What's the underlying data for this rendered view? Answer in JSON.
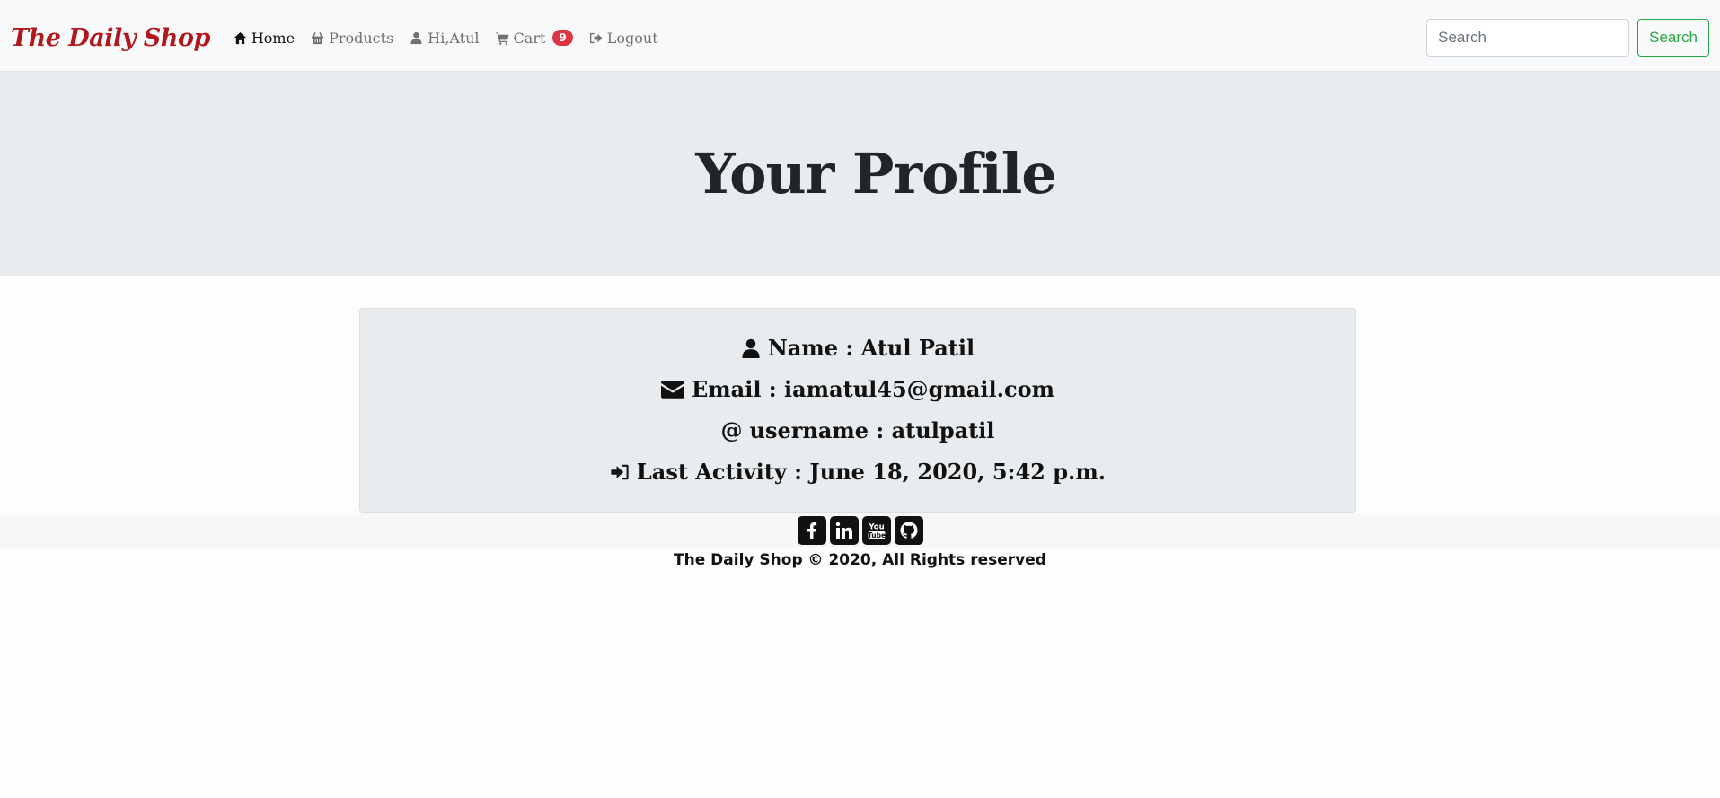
{
  "nav": {
    "brand": "The Daily Shop",
    "items": [
      {
        "label": "Home",
        "icon": "home-icon",
        "active": true
      },
      {
        "label": "Products",
        "icon": "basket-icon"
      },
      {
        "label": "Hi,Atul",
        "icon": "user-icon"
      },
      {
        "label": "Cart",
        "icon": "cart-icon",
        "badge": "9"
      },
      {
        "label": "Logout",
        "icon": "logout-icon"
      }
    ],
    "search_placeholder": "Search",
    "search_button": "Search"
  },
  "header": {
    "title": "Your Profile"
  },
  "profile": {
    "name_label": "Name : Atul Patil",
    "email_label": "Email : iamatul45@gmail.com",
    "username_prefix": "@",
    "username_label": "username : atulpatil",
    "activity_label": "Last Activity : June 18, 2020, 5:42 p.m."
  },
  "footer": {
    "social": [
      "facebook-icon",
      "linkedin-icon",
      "youtube-icon",
      "github-icon"
    ],
    "copyright": "The Daily Shop © 2020, All Rights reserved"
  },
  "colors": {
    "brand": "#b0181b",
    "badge": "#dc3545",
    "search_button": "#28a745",
    "jumbotron": "#e9ecef"
  }
}
